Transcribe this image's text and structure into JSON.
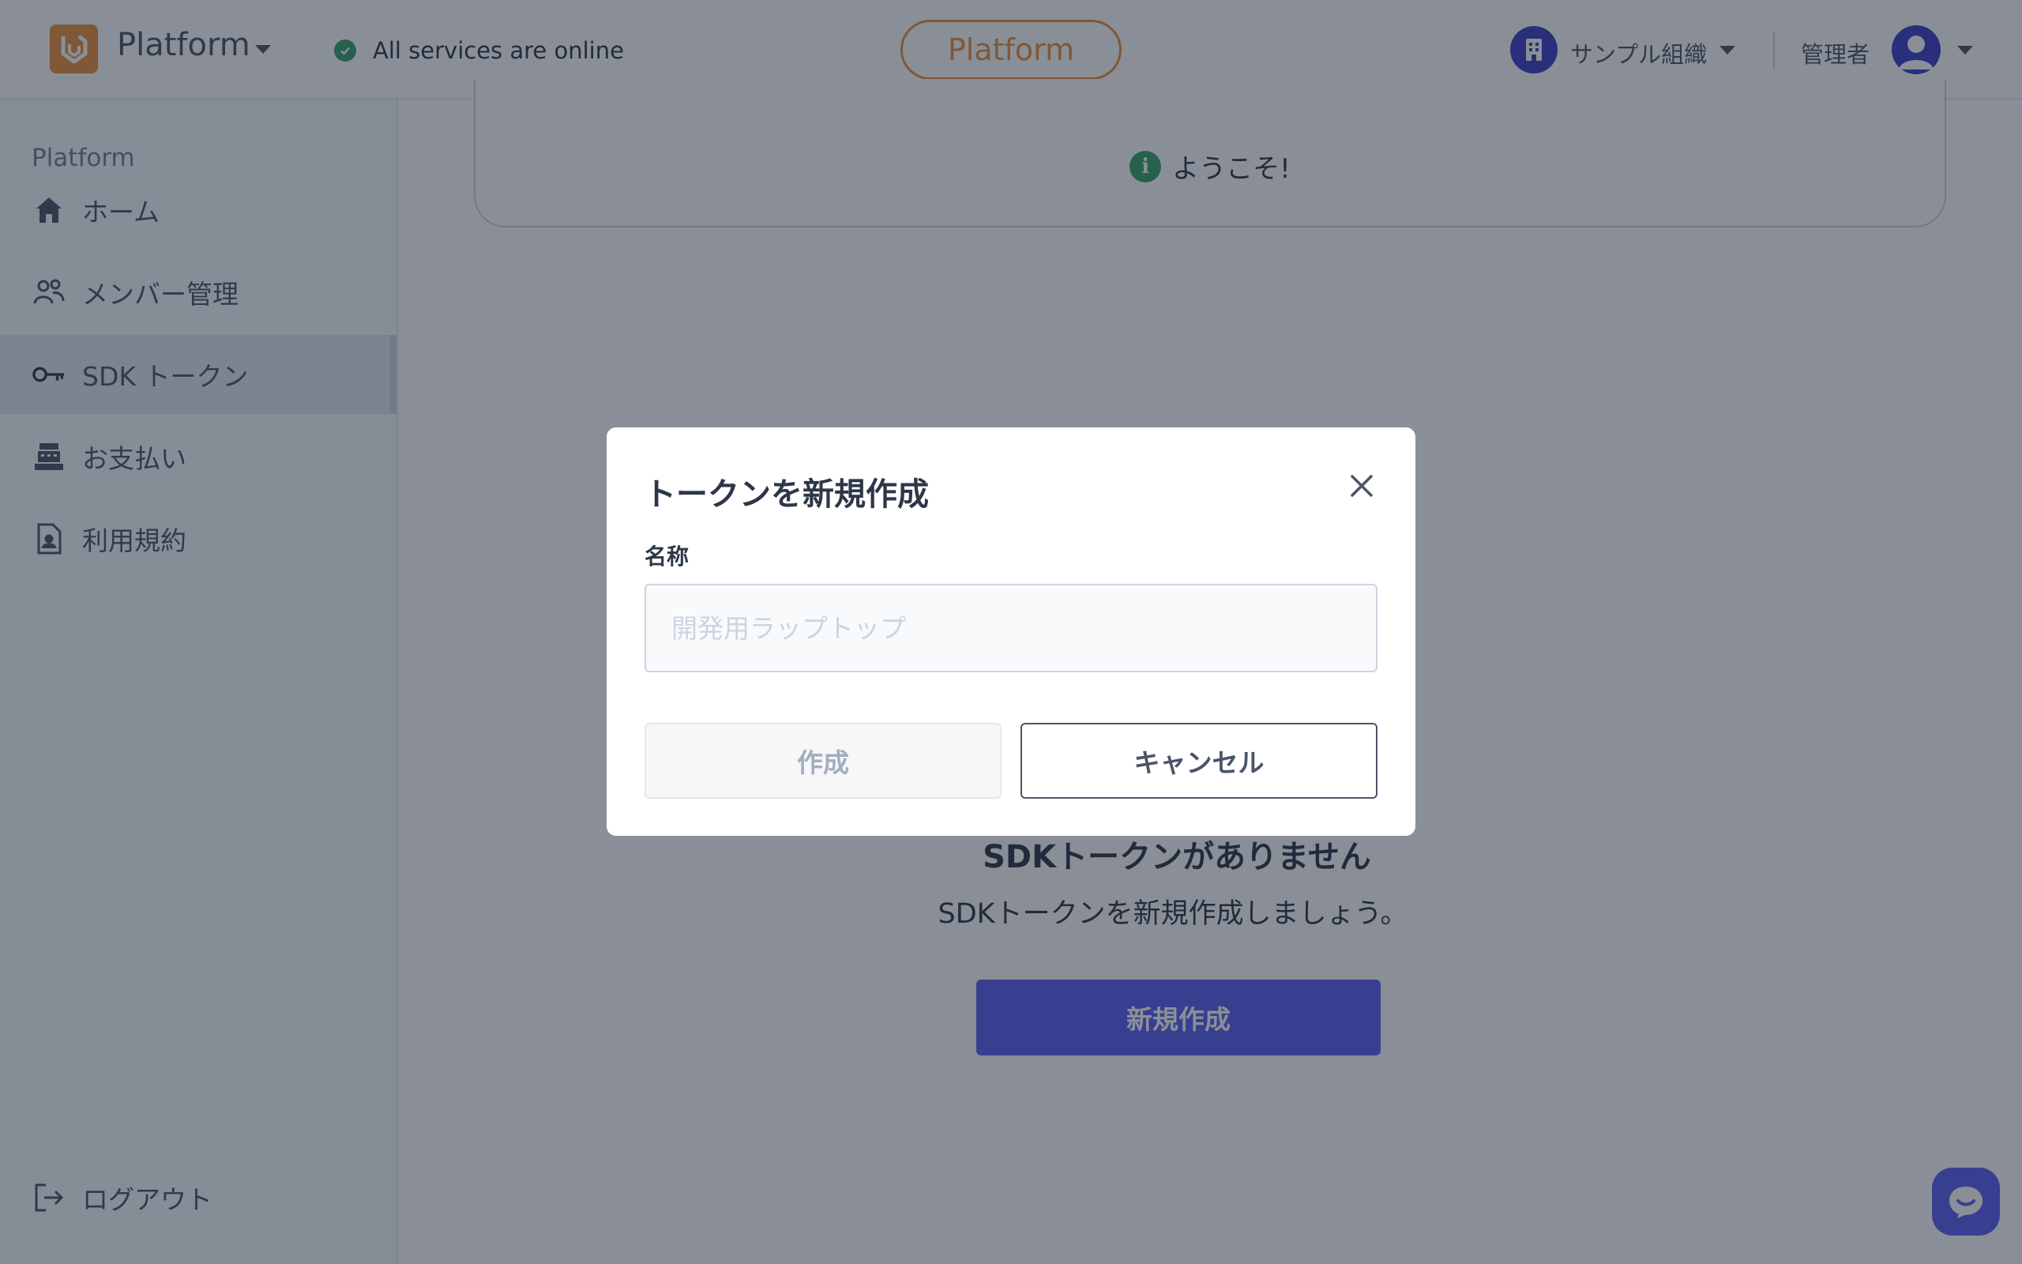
{
  "header": {
    "brand": "Platform",
    "status_text": "All services are online",
    "env_label": "Platform",
    "org_name": "サンプル組織",
    "role": "管理者"
  },
  "sidebar": {
    "section_title": "Platform",
    "items": [
      {
        "label": "ホーム",
        "icon": "home-icon"
      },
      {
        "label": "メンバー管理",
        "icon": "members-icon"
      },
      {
        "label": "SDK トークン",
        "icon": "key-icon",
        "active": true
      },
      {
        "label": "お支払い",
        "icon": "cash-register-icon"
      },
      {
        "label": "利用規約",
        "icon": "document-user-icon"
      }
    ],
    "logout": "ログアウト"
  },
  "main": {
    "welcome": "ようこそ!",
    "empty_title": "SDKトークンがありません",
    "empty_sub": "SDKトークンを新規作成しましょう。",
    "new_button": "新規作成"
  },
  "modal": {
    "title": "トークンを新規作成",
    "field_label": "名称",
    "field_value": "",
    "field_placeholder": "開発用ラップトップ",
    "create_label": "作成",
    "cancel_label": "キャンセル"
  },
  "colors": {
    "accent": "#5a5ef0",
    "brand_orange": "#e8913f",
    "status_green": "#38a169",
    "org_indigo": "#3c3fc4"
  }
}
